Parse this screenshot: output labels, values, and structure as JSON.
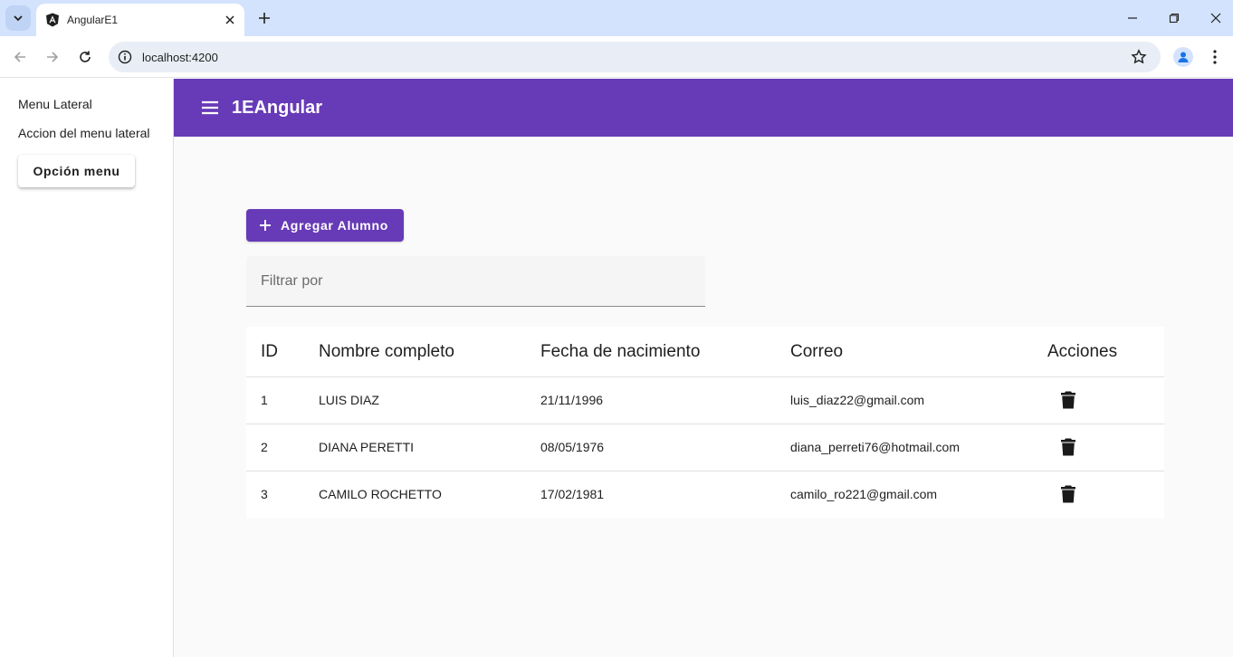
{
  "browser": {
    "tab_title": "AngularE1",
    "url": "localhost:4200"
  },
  "sidenav": {
    "title": "Menu Lateral",
    "action_text": "Accion del menu lateral",
    "button_label": "Opción menu"
  },
  "appbar": {
    "title": "1EAngular"
  },
  "main": {
    "add_button_label": "Agregar Alumno",
    "filter_placeholder": "Filtrar por"
  },
  "table": {
    "headers": [
      "ID",
      "Nombre completo",
      "Fecha de nacimiento",
      "Correo",
      "Acciones"
    ],
    "rows": [
      {
        "id": "1",
        "name": "LUIS DIAZ",
        "birth": "21/11/1996",
        "email": "luis_diaz22@gmail.com",
        "action_icon": "delete-icon"
      },
      {
        "id": "2",
        "name": "DIANA PERETTI",
        "birth": "08/05/1976",
        "email": "diana_perreti76@hotmail.com",
        "action_icon": "delete-icon"
      },
      {
        "id": "3",
        "name": "CAMILO ROCHETTO",
        "birth": "17/02/1981",
        "email": "camilo_ro221@gmail.com",
        "action_icon": "delete-icon"
      }
    ]
  },
  "colors": {
    "primary": "#673ab7",
    "tabbar": "#d3e3fd",
    "content_bg": "#fafafa"
  }
}
